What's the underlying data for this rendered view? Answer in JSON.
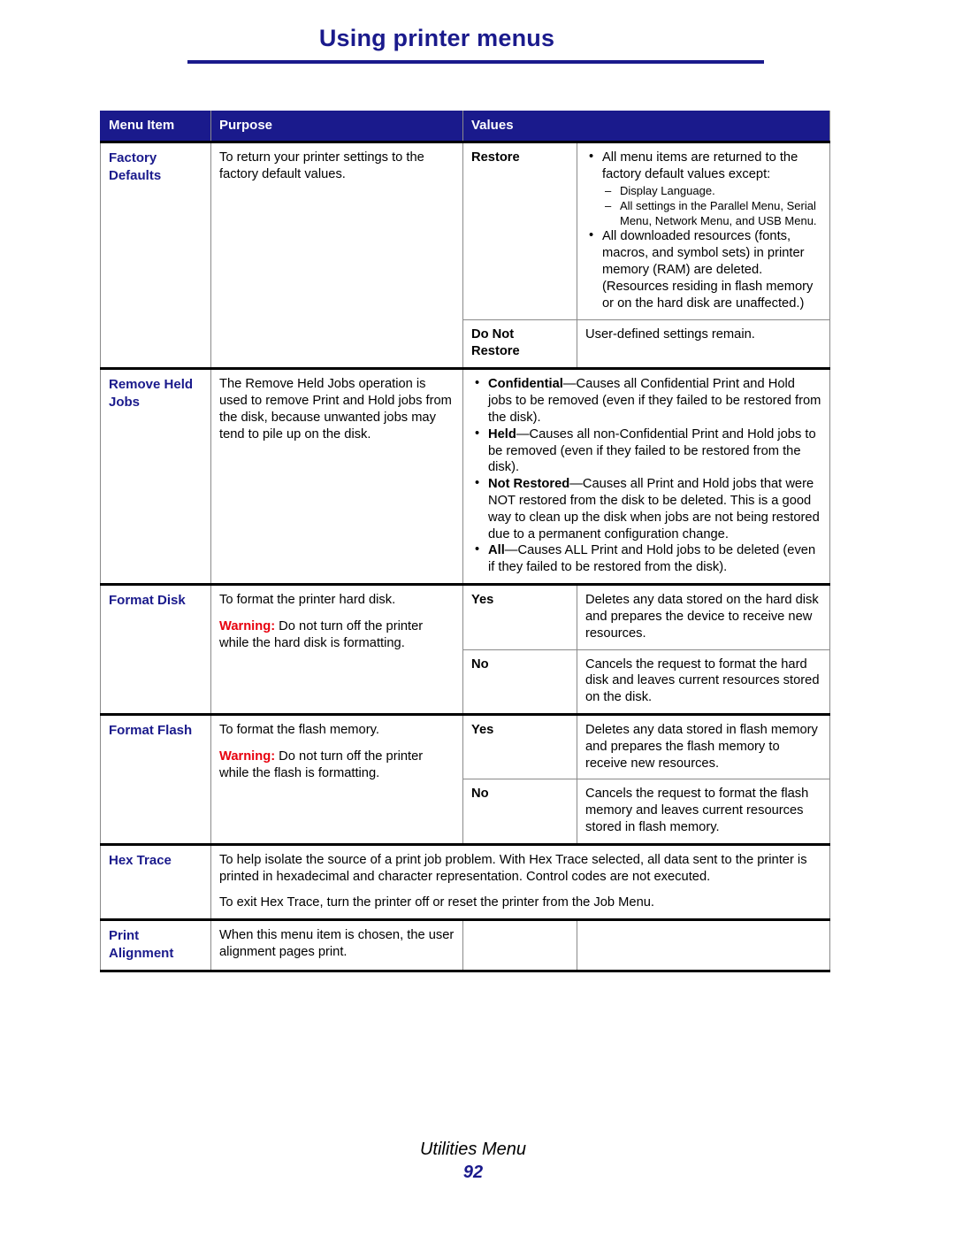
{
  "header": {
    "title": "Using printer menus"
  },
  "table": {
    "columns": [
      "Menu Item",
      "Purpose",
      "Values"
    ],
    "rows": [
      {
        "menu_item": "Factory Defaults",
        "menu_item_lines": [
          "Factory",
          "Defaults"
        ],
        "purpose": "To return your printer settings to the factory default values.",
        "values": [
          {
            "name": "Restore",
            "bullets": [
              {
                "text": "All menu items are returned to the factory default values except:",
                "subitems": [
                  "Display Language.",
                  "All settings in the Parallel Menu, Serial Menu, Network Menu, and USB Menu."
                ]
              },
              {
                "text": "All downloaded resources (fonts, macros, and symbol sets) in printer memory (RAM) are deleted. (Resources residing in flash memory or on the hard disk are unaffected.)"
              }
            ]
          },
          {
            "name": "Do Not Restore",
            "name_lines": [
              "Do Not",
              "Restore"
            ],
            "description": "User-defined settings remain."
          }
        ]
      },
      {
        "menu_item": "Remove Held Jobs",
        "menu_item_lines": [
          "Remove Held",
          "Jobs"
        ],
        "purpose": "The Remove Held Jobs operation is used to remove Print and Hold jobs from the disk, because unwanted jobs may tend to pile up on the disk.",
        "values_full": [
          {
            "lead": "Confidential",
            "rest": "—Causes all Confidential Print and Hold jobs to be removed (even if they failed to be restored from the disk)."
          },
          {
            "lead": "Held",
            "rest": "—Causes all non-Confidential Print and Hold jobs to be removed (even if they failed to be restored from the disk)."
          },
          {
            "lead": "Not Restored",
            "rest": "—Causes all Print and Hold jobs that were NOT restored from the disk to be deleted. This is a good way to clean up the disk when jobs are not being restored due to a permanent configuration change."
          },
          {
            "lead": "All",
            "rest": "—Causes ALL Print and Hold jobs to be deleted (even if they failed to be restored from the disk)."
          }
        ]
      },
      {
        "menu_item": "Format Disk",
        "purpose_line1": "To format the printer hard disk.",
        "warning_label": "Warning:",
        "warning_text": " Do not turn off the printer while the hard disk is formatting.",
        "values": [
          {
            "name": "Yes",
            "description": "Deletes any data stored on the hard disk and prepares the device to receive new resources."
          },
          {
            "name": "No",
            "description": "Cancels the request to format the hard disk and leaves current resources stored on the disk."
          }
        ]
      },
      {
        "menu_item": "Format Flash",
        "purpose_line1": "To format the flash memory.",
        "warning_label": "Warning:",
        "warning_text": " Do not turn off the printer while the flash is formatting.",
        "values": [
          {
            "name": "Yes",
            "description": "Deletes any data stored in flash memory and prepares the flash memory to receive new resources."
          },
          {
            "name": "No",
            "description": "Cancels the request to format the flash memory and leaves current resources stored in flash memory."
          }
        ]
      },
      {
        "menu_item": "Hex Trace",
        "purpose_para1": "To help isolate the source of a print job problem. With Hex Trace selected, all data sent to the printer is printed in hexadecimal and character representation. Control codes are not executed.",
        "purpose_para2": "To exit Hex Trace, turn the printer off or reset the printer from the Job Menu."
      },
      {
        "menu_item": "Print Alignment",
        "menu_item_lines": [
          "Print",
          "Alignment"
        ],
        "purpose": "When this menu item is chosen, the user alignment pages print.",
        "values": [
          {
            "name": "",
            "description": ""
          }
        ]
      }
    ]
  },
  "footer": {
    "chapter": "Utilities Menu",
    "page_number": "92"
  }
}
